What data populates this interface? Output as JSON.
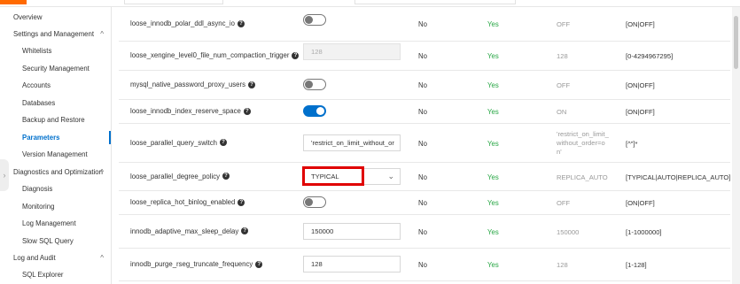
{
  "sidebar": {
    "items": [
      {
        "label": "Overview",
        "level": 1
      },
      {
        "label": "Settings and Management",
        "level": 1,
        "chevron": "^"
      },
      {
        "label": "Whitelists",
        "level": 2
      },
      {
        "label": "Security Management",
        "level": 2
      },
      {
        "label": "Accounts",
        "level": 2
      },
      {
        "label": "Databases",
        "level": 2
      },
      {
        "label": "Backup and Restore",
        "level": 2
      },
      {
        "label": "Parameters",
        "level": 2,
        "active": true
      },
      {
        "label": "Version Management",
        "level": 2
      },
      {
        "label": "Diagnostics and Optimization",
        "level": 1,
        "chevron": "^"
      },
      {
        "label": "Diagnosis",
        "level": 2
      },
      {
        "label": "Monitoring",
        "level": 2
      },
      {
        "label": "Log Management",
        "level": 2
      },
      {
        "label": "Slow SQL Query",
        "level": 2
      },
      {
        "label": "Log and Audit",
        "level": 1,
        "chevron": "^"
      },
      {
        "label": "SQL Explorer",
        "level": 2
      }
    ],
    "collapse_handle": "›"
  },
  "params": [
    {
      "name": "loose_innodb_polar_ddl_async_io",
      "control": "toggle",
      "on": false,
      "restart": "No",
      "modifiable": "Yes",
      "default": "OFF",
      "range": "[ON|OFF]"
    },
    {
      "name": "loose_xengine_level0_file_num_compaction_trigger",
      "control": "input-disabled",
      "value": "128",
      "restart": "No",
      "modifiable": "Yes",
      "default": "128",
      "range": "[0-4294967295]"
    },
    {
      "name": "mysql_native_password_proxy_users",
      "control": "toggle",
      "on": false,
      "restart": "No",
      "modifiable": "Yes",
      "default": "OFF",
      "range": "[ON|OFF]"
    },
    {
      "name": "loose_innodb_index_reserve_space",
      "control": "toggle",
      "on": true,
      "restart": "No",
      "modifiable": "Yes",
      "default": "ON",
      "range": "[ON|OFF]"
    },
    {
      "name": "loose_parallel_query_switch",
      "control": "input",
      "value": "'restrict_on_limit_without_or",
      "restart": "No",
      "modifiable": "Yes",
      "default": "'restrict_on_limit_\nwithout_order=o\nn'",
      "range": "[^\"]*"
    },
    {
      "name": "loose_parallel_degree_policy",
      "control": "select",
      "value": "TYPICAL",
      "highlighted": true,
      "restart": "No",
      "modifiable": "Yes",
      "default": "REPLICA_AUTO",
      "range": "[TYPICAL|AUTO|REPLICA_AUTO]"
    },
    {
      "name": "loose_replica_hot_binlog_enabled",
      "control": "toggle",
      "on": false,
      "restart": "No",
      "modifiable": "Yes",
      "default": "OFF",
      "range": "[ON|OFF]"
    },
    {
      "name": "innodb_adaptive_max_sleep_delay",
      "control": "input",
      "value": "150000",
      "restart": "No",
      "modifiable": "Yes",
      "default": "150000",
      "range": "[1-1000000]"
    },
    {
      "name": "innodb_purge_rseg_truncate_frequency",
      "control": "input",
      "value": "128",
      "restart": "No",
      "modifiable": "Yes",
      "default": "128",
      "range": "[1-128]"
    }
  ],
  "icons": {
    "help": "question-circle-icon",
    "select_arrow": "chevron-down-icon"
  },
  "colors": {
    "accent": "#0070cc",
    "yes": "#28a745",
    "highlight": "#e00000",
    "brand": "#ff6a00"
  }
}
